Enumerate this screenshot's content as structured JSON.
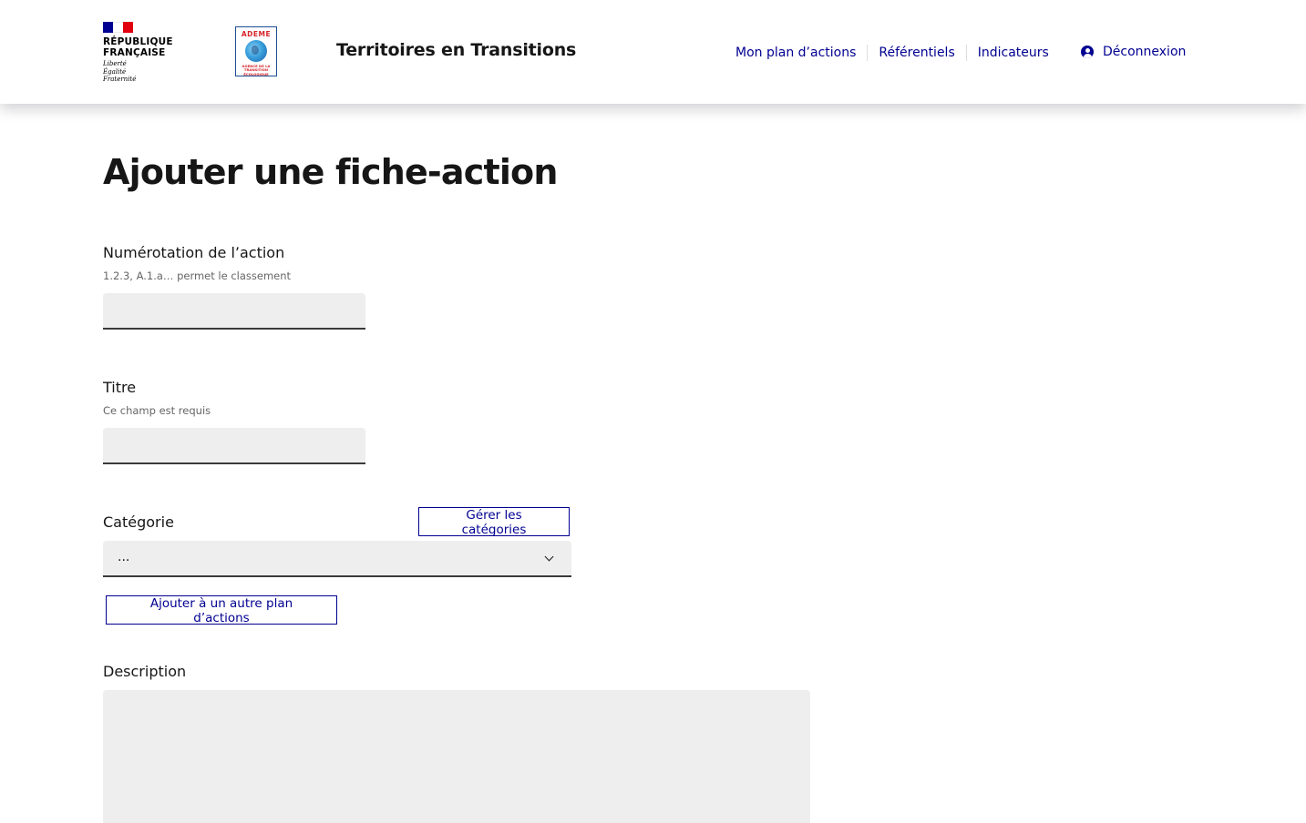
{
  "header": {
    "rf_logo": {
      "line1": "RÉPUBLIQUE",
      "line2": "FRANÇAISE",
      "motto": [
        "Liberté",
        "Égalité",
        "Fraternité"
      ]
    },
    "ademe_logo": {
      "title": "ADEME",
      "subtitle": [
        "AGENCE DE LA",
        "TRANSITION",
        "ÉCOLOGIQUE"
      ]
    },
    "site_title": "Territoires en Transitions",
    "nav": [
      "Mon plan d’actions",
      "Référentiels",
      "Indicateurs"
    ],
    "logout_label": "Déconnexion"
  },
  "main": {
    "title": "Ajouter une fiche-action",
    "numerotation": {
      "label": "Numérotation de l’action",
      "hint": "1.2.3, A.1.a… permet le classement",
      "value": ""
    },
    "titre": {
      "label": "Titre",
      "hint": "Ce champ est requis",
      "value": ""
    },
    "categorie": {
      "label": "Catégorie",
      "manage_button": "Gérer les catégories",
      "selected": "..."
    },
    "add_to_plan_button": "Ajouter à un autre plan d’actions",
    "description": {
      "label": "Description",
      "value": ""
    }
  },
  "colors": {
    "accent": "#000091",
    "flag_blue": "#000091",
    "flag_white": "#ffffff",
    "flag_red": "#e1000f",
    "input_bg": "#eeeeee"
  },
  "icons": [
    "user-circle-icon",
    "chevron-down-icon",
    "globe-icon"
  ]
}
